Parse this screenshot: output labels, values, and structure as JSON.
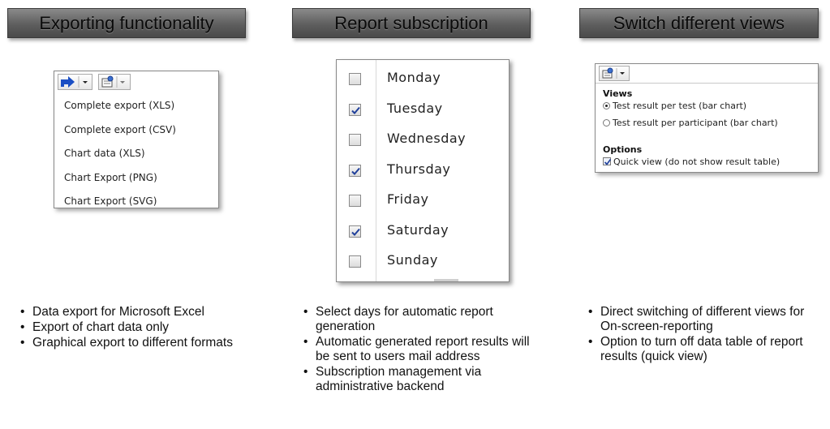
{
  "sections": [
    {
      "title": "Exporting functionality",
      "menu": [
        "Complete export (XLS)",
        "Complete export (CSV)",
        "Chart data (XLS)",
        "Chart Export (PNG)",
        "Chart Export (SVG)"
      ],
      "bullets": [
        "Data export for Microsoft Excel",
        "Export of chart data only",
        "Graphical export to different formats"
      ]
    },
    {
      "title": "Report subscription",
      "days": [
        {
          "label": "Monday",
          "checked": false
        },
        {
          "label": "Tuesday",
          "checked": true
        },
        {
          "label": "Wednesday",
          "checked": false
        },
        {
          "label": "Thursday",
          "checked": true
        },
        {
          "label": "Friday",
          "checked": false
        },
        {
          "label": "Saturday",
          "checked": true
        },
        {
          "label": "Sunday",
          "checked": false
        }
      ],
      "bullets": [
        "Select days for automatic report generation",
        "Automatic generated report results will be sent to users mail address",
        "Subscription management via administrative backend"
      ]
    },
    {
      "title": "Switch different views",
      "views_heading": "Views",
      "views": [
        {
          "label": "Test result per test (bar chart)",
          "selected": true
        },
        {
          "label": "Test result per participant (bar chart)",
          "selected": false
        }
      ],
      "options_heading": "Options",
      "options": [
        {
          "label": "Quick view (do not show result table)",
          "checked": true
        }
      ],
      "bullets": [
        "Direct switching of different views for On-screen-reporting",
        "Option to turn off data table of report results (quick view)"
      ]
    }
  ],
  "colors": {
    "header_bg": "#5e5e5e",
    "check_mark": "#1f3f9a",
    "export_arrow": "#1b4fc4"
  },
  "icons": {
    "export": "export-arrow-icon",
    "view": "view-selector-icon",
    "dropdown": "chevron-down-icon"
  }
}
